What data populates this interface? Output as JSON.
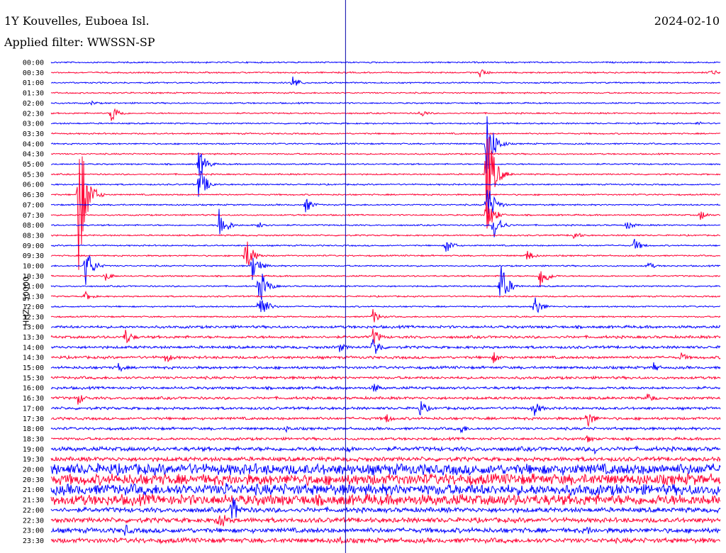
{
  "header": {
    "station": "1Y Kouvelles, Euboea Isl.",
    "filter": "Applied filter: WWSSN-SP",
    "date": "2024-02-10"
  },
  "chart_data": {
    "type": "line",
    "title": "1Y Kouvelles, Euboea Isl.",
    "subtitle": "Applied filter: WWSSN-SP",
    "ylabel": "HHZ - 50000",
    "xlabel": "",
    "row_labels": [
      "00:00",
      "00:30",
      "01:00",
      "01:30",
      "02:00",
      "02:30",
      "03:00",
      "03:30",
      "04:00",
      "04:30",
      "05:00",
      "05:30",
      "06:00",
      "06:30",
      "07:00",
      "07:30",
      "08:00",
      "08:30",
      "09:00",
      "09:30",
      "10:00",
      "10:30",
      "11:00",
      "11:30",
      "12:00",
      "12:30",
      "13:00",
      "13:30",
      "14:00",
      "14:30",
      "15:00",
      "15:30",
      "16:00",
      "16:30",
      "17:00",
      "17:30",
      "18:00",
      "18:30",
      "19:00",
      "19:30",
      "20:00",
      "20:30",
      "21:00",
      "21:30",
      "22:00",
      "22:30",
      "23:00",
      "23:30"
    ],
    "trace_colors": [
      "#0000ff",
      "#ff0033"
    ],
    "marker_line_color": "#0000aa",
    "marker_line_fraction": 0.44,
    "events": [
      {
        "row": 1,
        "pos": 0.64,
        "amp": 8
      },
      {
        "row": 1,
        "pos": 0.985,
        "amp": 6
      },
      {
        "row": 2,
        "pos": 0.36,
        "amp": 12
      },
      {
        "row": 4,
        "pos": 0.06,
        "amp": 4
      },
      {
        "row": 5,
        "pos": 0.09,
        "amp": 16
      },
      {
        "row": 5,
        "pos": 0.55,
        "amp": 8
      },
      {
        "row": 6,
        "pos": 0.965,
        "amp": 4
      },
      {
        "row": 8,
        "pos": 0.65,
        "amp": 60
      },
      {
        "row": 10,
        "pos": 0.22,
        "amp": 25
      },
      {
        "row": 11,
        "pos": 0.65,
        "amp": 90
      },
      {
        "row": 12,
        "pos": 0.22,
        "amp": 30
      },
      {
        "row": 13,
        "pos": 0.04,
        "amp": 130
      },
      {
        "row": 14,
        "pos": 0.38,
        "amp": 12
      },
      {
        "row": 14,
        "pos": 0.65,
        "amp": 40
      },
      {
        "row": 15,
        "pos": 0.65,
        "amp": 30
      },
      {
        "row": 15,
        "pos": 0.97,
        "amp": 8
      },
      {
        "row": 16,
        "pos": 0.25,
        "amp": 30
      },
      {
        "row": 16,
        "pos": 0.31,
        "amp": 8
      },
      {
        "row": 16,
        "pos": 0.66,
        "amp": 25
      },
      {
        "row": 16,
        "pos": 0.86,
        "amp": 8
      },
      {
        "row": 17,
        "pos": 0.78,
        "amp": 8
      },
      {
        "row": 18,
        "pos": 0.59,
        "amp": 12
      },
      {
        "row": 18,
        "pos": 0.87,
        "amp": 12
      },
      {
        "row": 19,
        "pos": 0.29,
        "amp": 30
      },
      {
        "row": 19,
        "pos": 0.71,
        "amp": 10
      },
      {
        "row": 20,
        "pos": 0.05,
        "amp": 35
      },
      {
        "row": 20,
        "pos": 0.3,
        "amp": 24
      },
      {
        "row": 20,
        "pos": 0.89,
        "amp": 8
      },
      {
        "row": 21,
        "pos": 0.08,
        "amp": 8
      },
      {
        "row": 21,
        "pos": 0.73,
        "amp": 22
      },
      {
        "row": 22,
        "pos": 0.31,
        "amp": 32
      },
      {
        "row": 22,
        "pos": 0.67,
        "amp": 40
      },
      {
        "row": 23,
        "pos": 0.05,
        "amp": 8
      },
      {
        "row": 24,
        "pos": 0.31,
        "amp": 28
      },
      {
        "row": 24,
        "pos": 0.72,
        "amp": 20
      },
      {
        "row": 25,
        "pos": 0.48,
        "amp": 12
      },
      {
        "row": 27,
        "pos": 0.48,
        "amp": 16
      },
      {
        "row": 27,
        "pos": 0.11,
        "amp": 14
      },
      {
        "row": 28,
        "pos": 0.48,
        "amp": 20
      },
      {
        "row": 28,
        "pos": 0.43,
        "amp": 8
      },
      {
        "row": 29,
        "pos": 0.17,
        "amp": 10
      },
      {
        "row": 29,
        "pos": 0.66,
        "amp": 10
      },
      {
        "row": 29,
        "pos": 0.94,
        "amp": 9
      },
      {
        "row": 30,
        "pos": 0.1,
        "amp": 8
      },
      {
        "row": 30,
        "pos": 0.9,
        "amp": 8
      },
      {
        "row": 32,
        "pos": 0.48,
        "amp": 10
      },
      {
        "row": 33,
        "pos": 0.04,
        "amp": 10
      },
      {
        "row": 33,
        "pos": 0.89,
        "amp": 10
      },
      {
        "row": 34,
        "pos": 0.55,
        "amp": 16
      },
      {
        "row": 34,
        "pos": 0.72,
        "amp": 14
      },
      {
        "row": 35,
        "pos": 0.8,
        "amp": 16
      },
      {
        "row": 35,
        "pos": 0.5,
        "amp": 8
      },
      {
        "row": 36,
        "pos": 0.61,
        "amp": 10
      },
      {
        "row": 36,
        "pos": 0.35,
        "amp": 6
      },
      {
        "row": 37,
        "pos": 0.8,
        "amp": 8
      },
      {
        "row": 38,
        "pos": 0.81,
        "amp": 10
      },
      {
        "row": 38,
        "pos": 0.44,
        "amp": 8
      },
      {
        "row": 42,
        "pos": 0.26,
        "amp": 14
      },
      {
        "row": 44,
        "pos": 0.27,
        "amp": 24
      },
      {
        "row": 45,
        "pos": 0.25,
        "amp": 20
      },
      {
        "row": 46,
        "pos": 0.11,
        "amp": 10
      },
      {
        "row": 46,
        "pos": 0.8,
        "amp": 8
      },
      {
        "row": 47,
        "pos": 0.43,
        "amp": 10
      }
    ]
  }
}
